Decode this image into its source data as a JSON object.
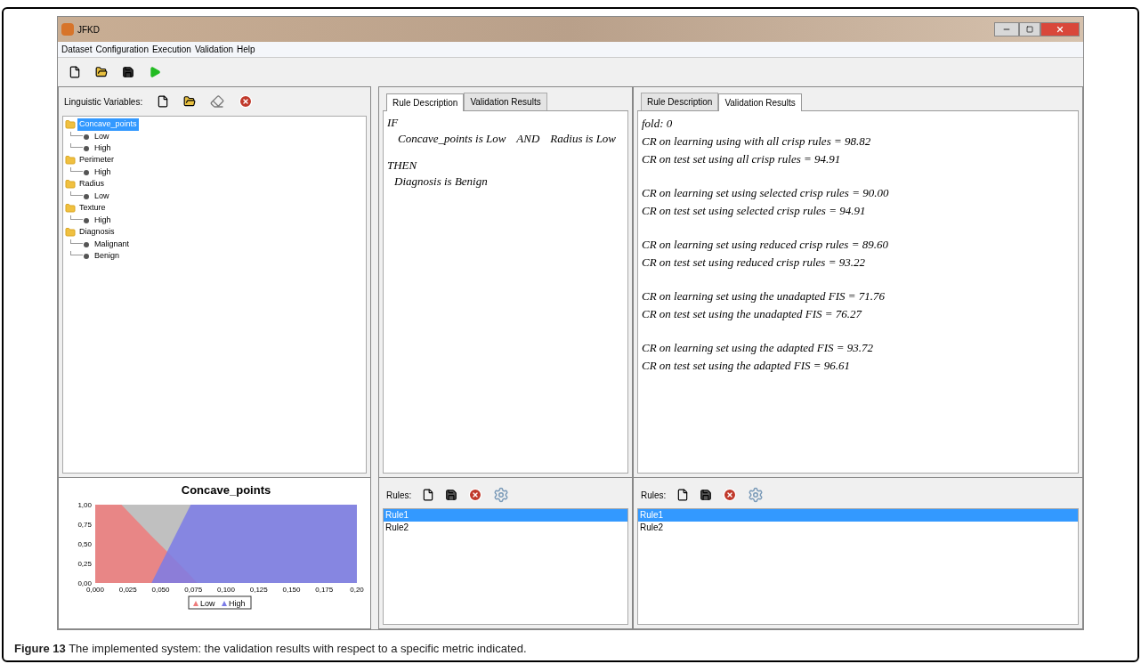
{
  "window": {
    "title": "JFKD"
  },
  "menu": [
    "Dataset",
    "Configuration",
    "Execution",
    "Validation",
    "Help"
  ],
  "variables": {
    "label": "Linguistic Variables:",
    "tree": [
      {
        "label": "Concave_points",
        "selected": true,
        "children": [
          {
            "label": "Low",
            "selected": false
          },
          {
            "label": "High",
            "selected": false
          }
        ]
      },
      {
        "label": "Perimeter",
        "selected": false,
        "children": [
          {
            "label": "High",
            "selected": false
          }
        ]
      },
      {
        "label": "Radius",
        "selected": false,
        "children": [
          {
            "label": "Low",
            "selected": false
          }
        ]
      },
      {
        "label": "Texture",
        "selected": false,
        "children": [
          {
            "label": "High",
            "selected": false
          }
        ]
      },
      {
        "label": "Diagnosis",
        "selected": false,
        "children": [
          {
            "label": "Malignant",
            "selected": false
          },
          {
            "label": "Benign",
            "selected": false
          }
        ]
      }
    ],
    "chart_data": {
      "type": "area",
      "title": "Concave_points",
      "x": [
        0,
        0.02,
        0.043,
        0.055,
        0.073,
        0.078,
        0.2
      ],
      "series": [
        {
          "name": "Low",
          "color": "#ee7b7b",
          "values": [
            1,
            1,
            0.6,
            0.4,
            0.09,
            0,
            null
          ]
        },
        {
          "name": "High",
          "color": "#7b7be6",
          "values": [
            null,
            null,
            0,
            0.4,
            1,
            1,
            1
          ]
        }
      ],
      "legend": "bottom",
      "xlim": [
        0,
        0.2
      ],
      "ylim": [
        0,
        1
      ],
      "xticks": [
        {
          "value": 0,
          "label": "0,000"
        },
        {
          "value": 0.025,
          "label": "0,025"
        },
        {
          "value": 0.05,
          "label": "0,050"
        },
        {
          "value": 0.075,
          "label": "0,075"
        },
        {
          "value": 0.1,
          "label": "0,100"
        },
        {
          "value": 0.125,
          "label": "0,125"
        },
        {
          "value": 0.15,
          "label": "0,150"
        },
        {
          "value": 0.175,
          "label": "0,175"
        },
        {
          "value": 0.2,
          "label": "0,20"
        }
      ],
      "yticks": [
        {
          "value": 0,
          "label": "0,00"
        },
        {
          "value": 0.25,
          "label": "0,25"
        },
        {
          "value": 0.5,
          "label": "0,50"
        },
        {
          "value": 0.75,
          "label": "0,75"
        },
        {
          "value": 1,
          "label": "1,00"
        }
      ]
    }
  },
  "rule_panel": {
    "tabs": [
      {
        "label": "Rule Description",
        "selected": true
      },
      {
        "label": "Validation Results",
        "selected": false
      }
    ],
    "if": "IF",
    "conditions": [
      "Concave_points is Low",
      "AND",
      "Radius is Low"
    ],
    "then": "THEN",
    "conclusion": "Diagnosis is Benign",
    "rules_label": "Rules:",
    "rules": [
      {
        "label": "Rule1",
        "selected": true
      },
      {
        "label": "Rule2",
        "selected": false
      }
    ]
  },
  "results_panel": {
    "tabs": [
      {
        "label": "Rule Description",
        "selected": false
      },
      {
        "label": "Validation Results",
        "selected": true
      }
    ],
    "fold": "fold: 0",
    "groups": [
      [
        "CR on learning using with all crisp rules = 98.82",
        "CR on test set using all crisp rules = 94.91"
      ],
      [
        "CR on learning set using selected crisp rules = 90.00",
        "CR on test set using selected crisp rules = 94.91"
      ],
      [
        "CR on learning set using reduced crisp rules = 89.60",
        "CR on test set using reduced crisp rules = 93.22"
      ],
      [
        "CR on learning set using the unadapted FIS = 71.76",
        "CR on test set using the unadapted FIS = 76.27"
      ],
      [
        "CR on learning set using the adapted FIS = 93.72",
        "CR on test set using the adapted FIS = 96.61"
      ]
    ],
    "rules_label": "Rules:",
    "rules": [
      {
        "label": "Rule1",
        "selected": true
      },
      {
        "label": "Rule2",
        "selected": false
      }
    ]
  },
  "caption": "**Figure 13** The implemented system: the validation results with respect to a specific metric indicated."
}
